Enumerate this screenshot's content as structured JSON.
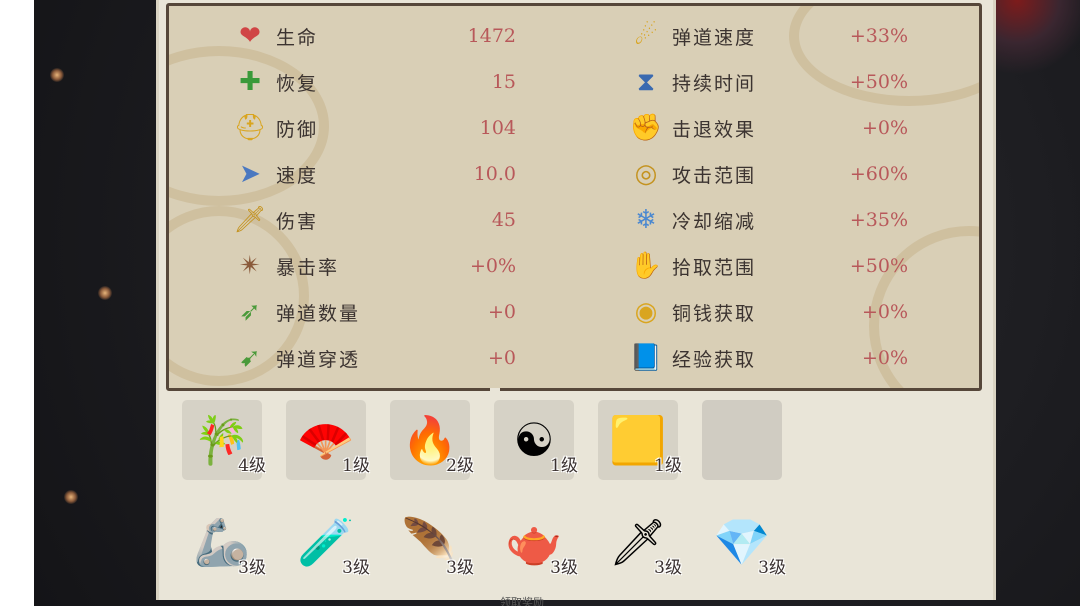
{
  "stats_left": [
    {
      "icon": "heart-icon",
      "glyph": "❤",
      "color": "#d04545",
      "label": "生命",
      "value": "1472"
    },
    {
      "icon": "plus-cross-icon",
      "glyph": "✚",
      "color": "#3a9a3a",
      "label": "恢复",
      "value": "15"
    },
    {
      "icon": "helmet-icon",
      "glyph": "⛑",
      "color": "#d9a520",
      "label": "防御",
      "value": "104"
    },
    {
      "icon": "wind-icon",
      "glyph": "➤",
      "color": "#4a78c0",
      "label": "速度",
      "value": "10.0"
    },
    {
      "icon": "sword-icon",
      "glyph": "🗡",
      "color": "#c49320",
      "label": "伤害",
      "value": "45"
    },
    {
      "icon": "shuriken-icon",
      "glyph": "✴",
      "color": "#8a5a3a",
      "label": "暴击率",
      "value": "+0%"
    },
    {
      "icon": "arrows-icon",
      "glyph": "➶",
      "color": "#4a9a3a",
      "label": "弹道数量",
      "value": "+0"
    },
    {
      "icon": "pierce-icon",
      "glyph": "➹",
      "color": "#4a9a3a",
      "label": "弹道穿透",
      "value": "+0"
    }
  ],
  "stats_right": [
    {
      "icon": "comet-icon",
      "glyph": "☄",
      "color": "#d9a520",
      "label": "弹道速度",
      "value": "+33%"
    },
    {
      "icon": "hourglass-icon",
      "glyph": "⧗",
      "color": "#3a6ab0",
      "label": "持续时间",
      "value": "+50%"
    },
    {
      "icon": "fist-icon",
      "glyph": "✊",
      "color": "#c03030",
      "label": "击退效果",
      "value": "+0%"
    },
    {
      "icon": "target-icon",
      "glyph": "◎",
      "color": "#c49320",
      "label": "攻击范围",
      "value": "+60%"
    },
    {
      "icon": "snowflake-icon",
      "glyph": "❄",
      "color": "#4a88d0",
      "label": "冷却缩减",
      "value": "+35%"
    },
    {
      "icon": "magnet-hand-icon",
      "glyph": "✋",
      "color": "#4a78c0",
      "label": "拾取范围",
      "value": "+50%"
    },
    {
      "icon": "coins-icon",
      "glyph": "◉",
      "color": "#d9a520",
      "label": "铜钱获取",
      "value": "+0%"
    },
    {
      "icon": "book-icon",
      "glyph": "📘",
      "color": "#3a6ab0",
      "label": "经验获取",
      "value": "+0%"
    }
  ],
  "weapons": [
    {
      "icon": "flute-icon",
      "glyph": "🎋",
      "level": "4级"
    },
    {
      "icon": "fan-icon",
      "glyph": "🪭",
      "level": "1级"
    },
    {
      "icon": "torch-icon",
      "glyph": "🔥",
      "level": "2级"
    },
    {
      "icon": "yin-yang-icon",
      "glyph": "☯",
      "level": "1级"
    },
    {
      "icon": "golden-scroll-icon",
      "glyph": "🟨",
      "level": "1级"
    },
    {
      "icon": "empty-slot-icon",
      "glyph": "",
      "level": ""
    }
  ],
  "passives": [
    {
      "icon": "bracer-icon",
      "glyph": "🦾",
      "level": "3级"
    },
    {
      "icon": "potion-icon",
      "glyph": "🧪",
      "level": "3级"
    },
    {
      "icon": "feather-fan-icon",
      "glyph": "🪶",
      "level": "3级"
    },
    {
      "icon": "teapot-icon",
      "glyph": "🫖",
      "level": "3级"
    },
    {
      "icon": "dagger-icon",
      "glyph": "🗡",
      "level": "3级"
    },
    {
      "icon": "crystal-icon",
      "glyph": "💎",
      "level": "3级"
    }
  ],
  "bottom_text": "领取奖励"
}
